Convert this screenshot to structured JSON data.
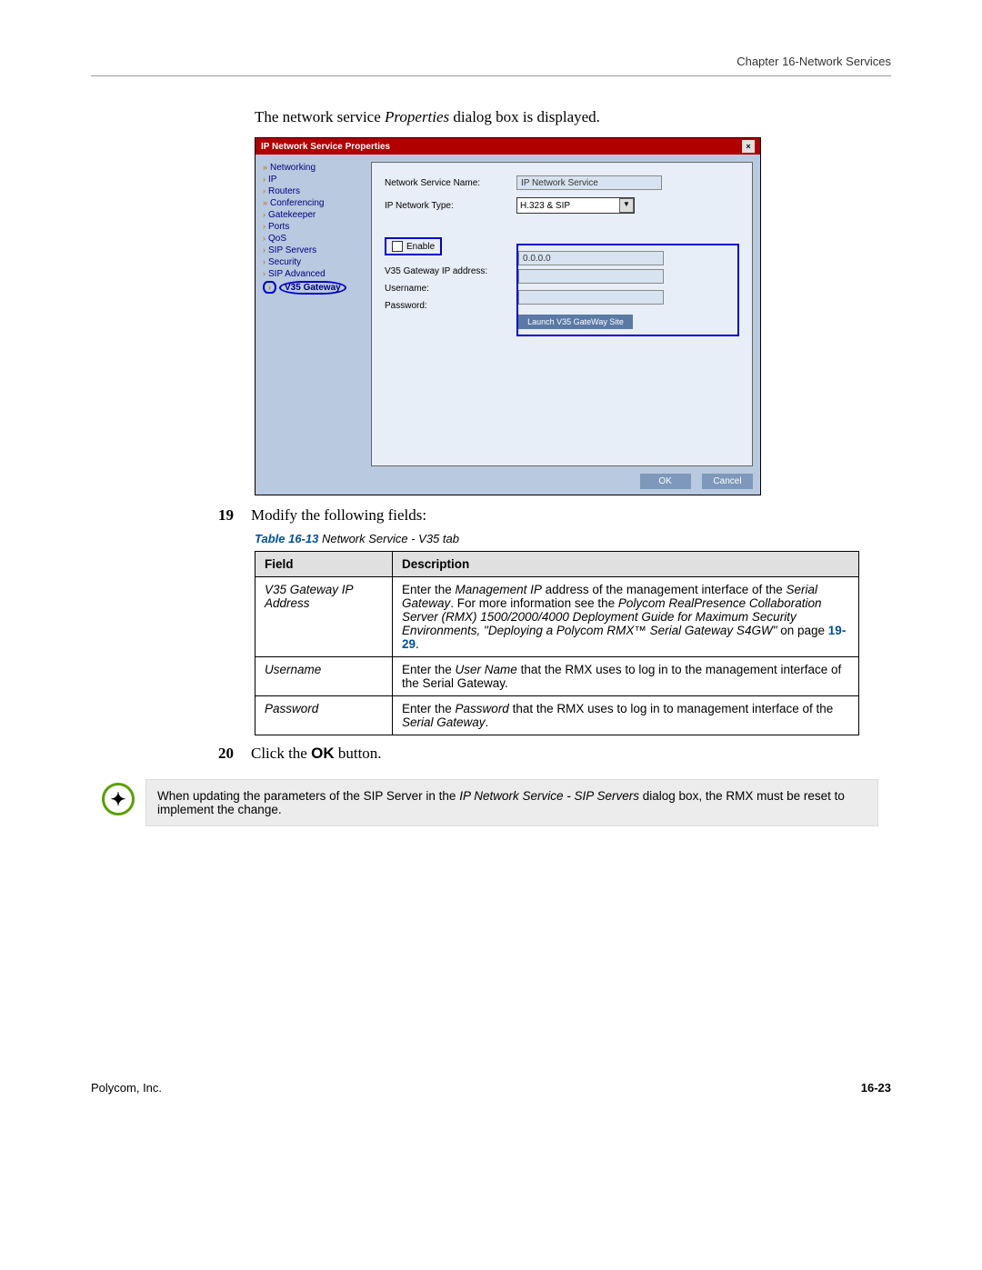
{
  "header": "Chapter 16-Network Services",
  "intro": {
    "pre": "The network service ",
    "italic": "Properties",
    "post": " dialog box is displayed."
  },
  "dialog": {
    "title": "IP Network Service Properties",
    "nav": [
      "Networking",
      "IP",
      "Routers",
      "Conferencing",
      "Gatekeeper",
      "Ports",
      "QoS",
      "SIP Servers",
      "Security",
      "SIP Advanced",
      "V35 Gateway"
    ],
    "labels": {
      "svcName": "Network Service Name:",
      "svcNameVal": "IP Network Service",
      "netType": "IP Network Type:",
      "netTypeVal": "H.323 & SIP",
      "enable": "Enable",
      "gwip": "V35 Gateway IP address:",
      "gwipVal": "0.0.0.0",
      "user": "Username:",
      "pass": "Password:",
      "launch": "Launch V35 GateWay Site"
    },
    "ok": "OK",
    "cancel": "Cancel"
  },
  "step19": {
    "num": "19",
    "text": "Modify the following fields:"
  },
  "tableCaption": {
    "a": "Table 16-13",
    "b": " Network Service - V35 tab"
  },
  "table": {
    "h1": "Field",
    "h2": "Description",
    "rows": [
      {
        "field": "V35 Gateway IP Address",
        "desc": {
          "p1": "Enter the ",
          "i1": "Management IP",
          "p2": " address of the management interface of the ",
          "i2": "Serial Gateway",
          "p3": ". For more information see the ",
          "i3": "Polycom RealPresence Collaboration Server (RMX) 1500/2000/4000 Deployment Guide for Maximum Security Environments, \"Deploying a Polycom RMX™ Serial Gateway S4GW\"",
          "p4": " on page ",
          "link": "19-29",
          "p5": "."
        }
      },
      {
        "field": "Username",
        "desc": {
          "p1": "Enter the ",
          "i1": "User Name",
          "p2": " that the RMX uses to log in to the management interface of the Serial Gateway."
        }
      },
      {
        "field": "Password",
        "desc": {
          "p1": "Enter the ",
          "i1": "Password",
          "p2": " that the RMX uses to log in to management interface of the ",
          "i2": "Serial Gateway",
          "p3": "."
        }
      }
    ]
  },
  "step20": {
    "num": "20",
    "pre": "Click the ",
    "bold": "OK",
    "post": " button."
  },
  "note": {
    "p1": "When updating the parameters of the SIP Server in the ",
    "i1": "IP Network Service - SIP Servers",
    "p2": " dialog box, the RMX must be reset to implement the change."
  },
  "footer": {
    "left": "Polycom, Inc.",
    "right": "16-23"
  }
}
